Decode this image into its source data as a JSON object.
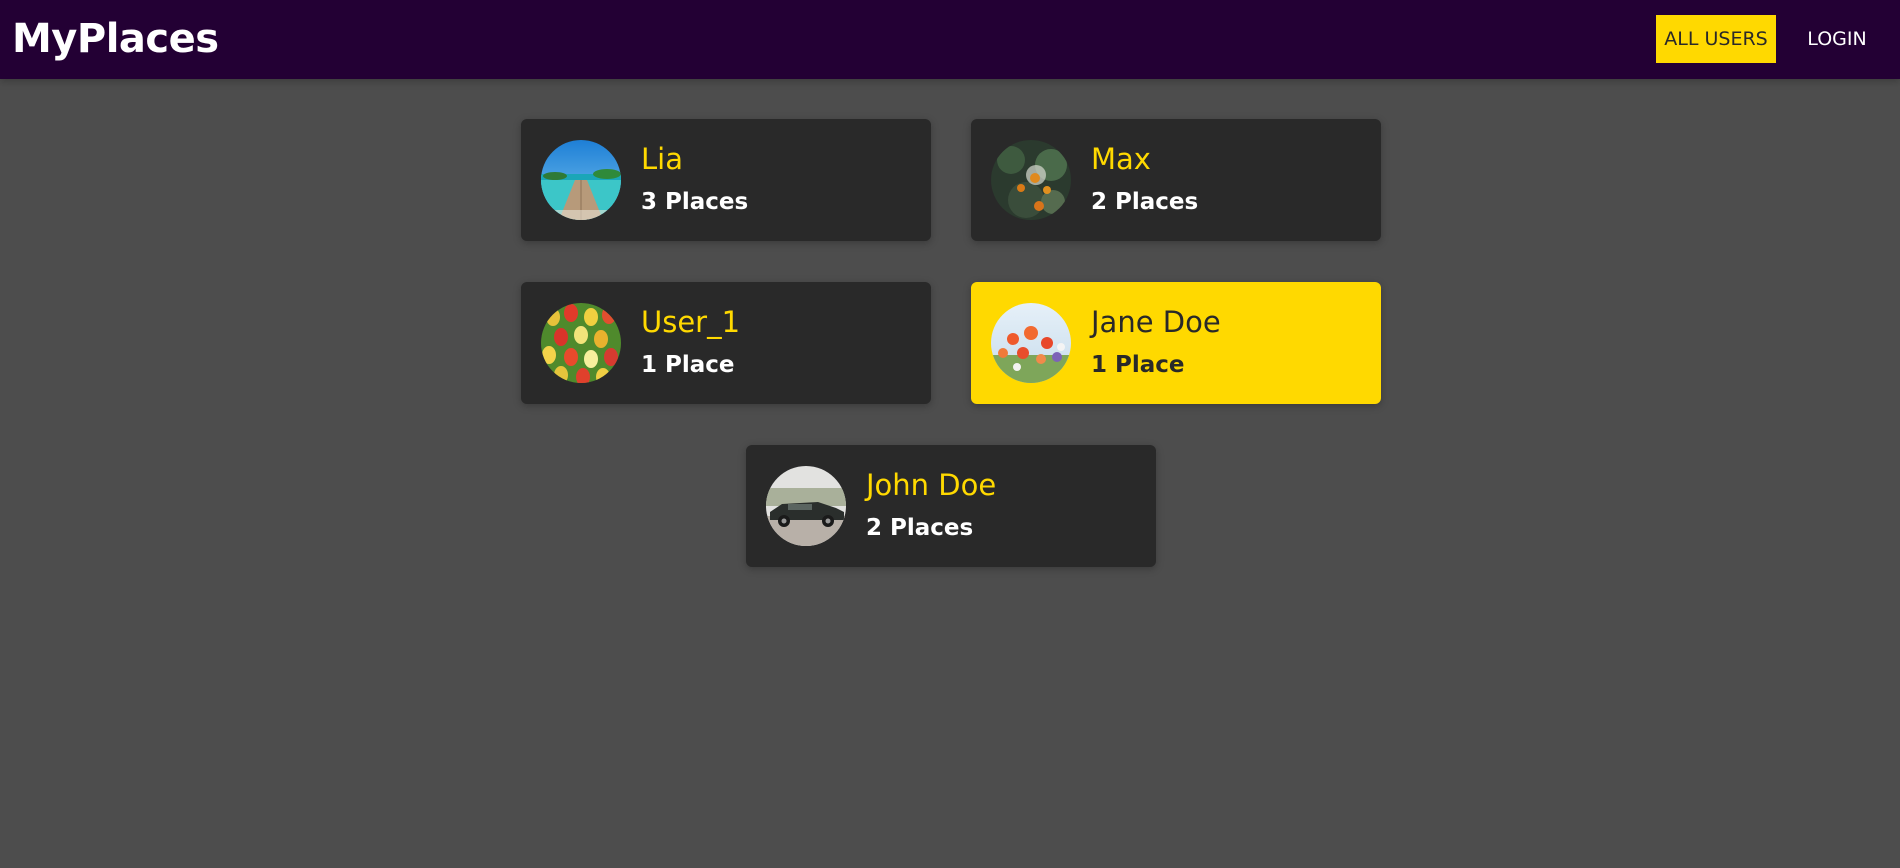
{
  "header": {
    "logo": "MyPlaces",
    "background": "#230034"
  },
  "nav": {
    "all_users": "ALL USERS",
    "login": "LOGIN",
    "active_color": "#ffd900"
  },
  "users": [
    {
      "name": "Lia",
      "places": "3 Places",
      "avatar": "beach-pier-photo",
      "active": false
    },
    {
      "name": "Max",
      "places": "2 Places",
      "avatar": "orange-tree-photo",
      "active": false
    },
    {
      "name": "User_1",
      "places": "1 Place",
      "avatar": "tulips-photo",
      "active": false
    },
    {
      "name": "Jane Doe",
      "places": "1 Place",
      "avatar": "poppy-field-photo",
      "active": true
    },
    {
      "name": "John Doe",
      "places": "2 Places",
      "avatar": "vintage-car-photo",
      "active": false
    }
  ],
  "colors": {
    "page_background": "#4d4d4d",
    "card_background": "#292929",
    "accent": "#ffd900"
  }
}
